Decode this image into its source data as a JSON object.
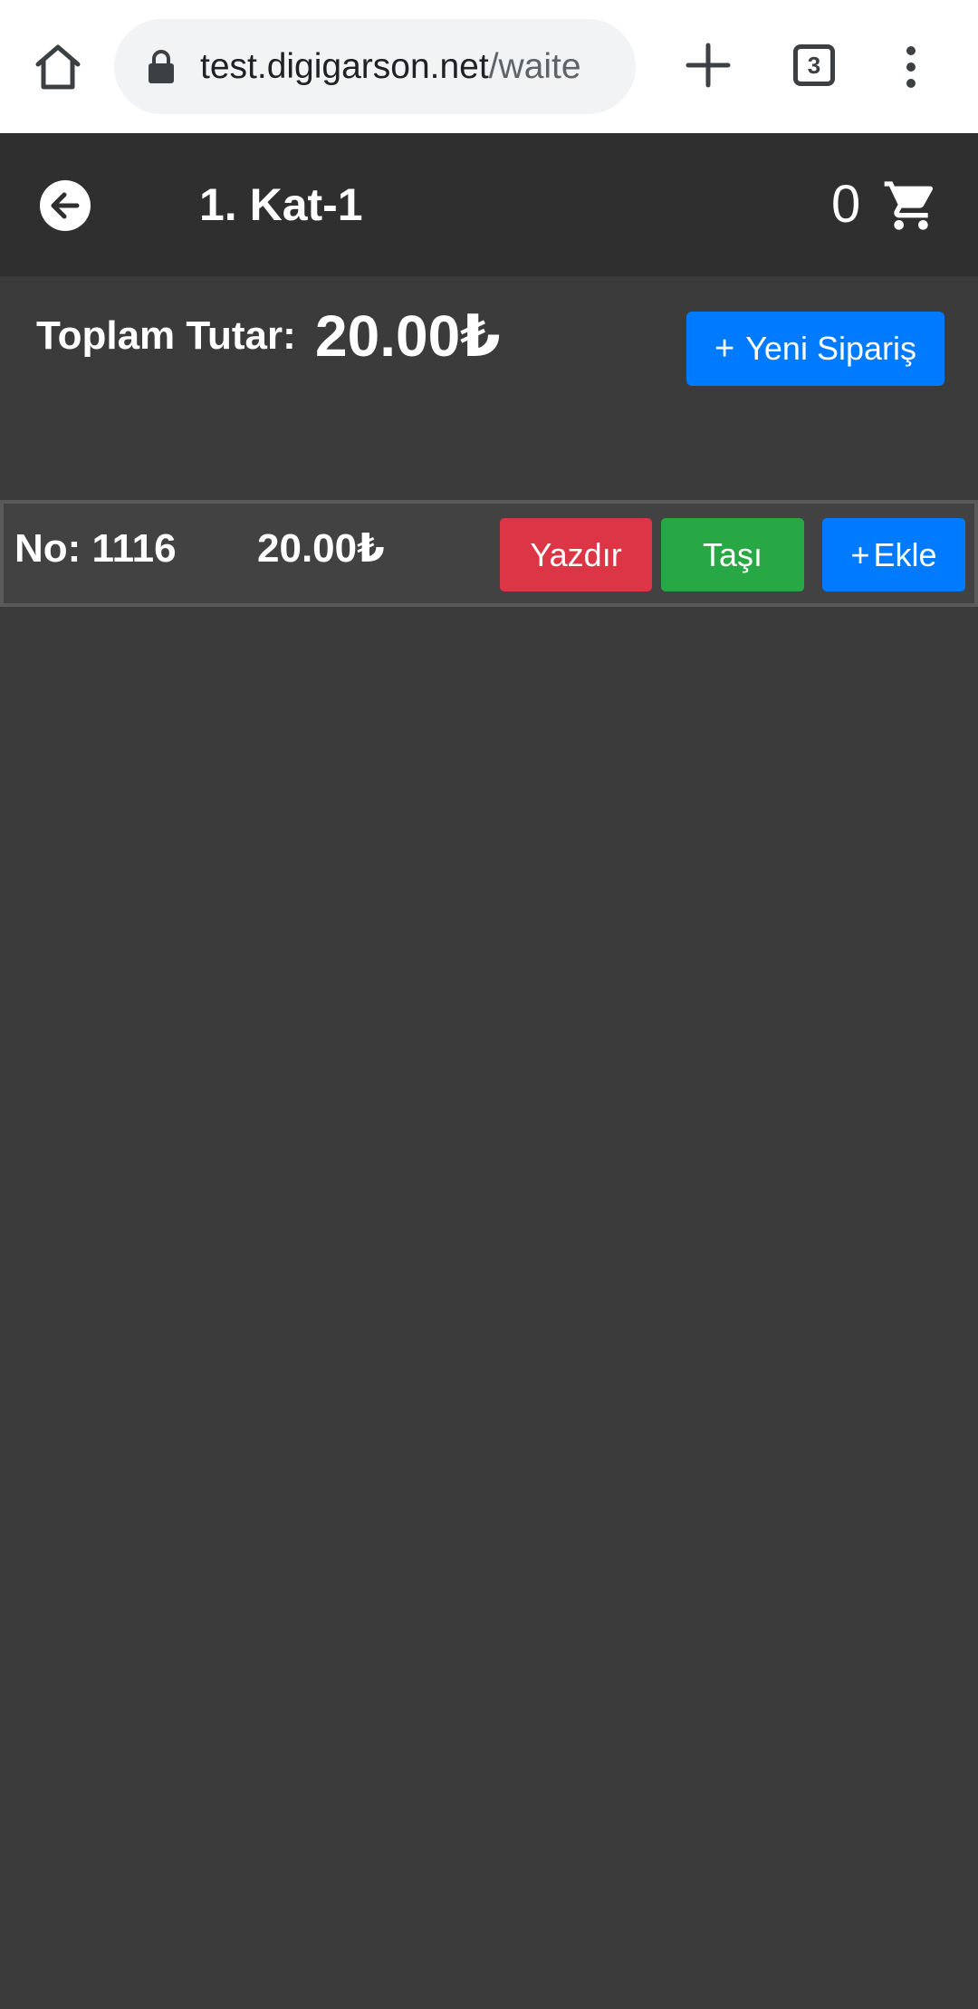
{
  "browser": {
    "url_host": "test.digigarson.net",
    "url_path": "/waite",
    "tab_count": "3"
  },
  "header": {
    "title": "1. Kat-1",
    "cart_count": "0"
  },
  "summary": {
    "total_label": "Toplam Tutar:",
    "total_value": "20.00₺",
    "new_order_label": "Yeni Sipariş"
  },
  "orders": [
    {
      "number": "No: 1116",
      "amount": "20.00₺",
      "print_label": "Yazdır",
      "move_label": "Taşı",
      "add_label": "Ekle"
    }
  ],
  "colors": {
    "background": "#3b3b3b",
    "header": "#2f2f2f",
    "primary": "#007bff",
    "danger": "#dc3545",
    "success": "#28a745"
  },
  "icons": {
    "home": "home-icon",
    "lock": "lock-icon",
    "new_tab": "plus-icon",
    "tabs": "tab-switcher-icon",
    "menu": "more-vert-icon",
    "back": "arrow-back-circle-icon",
    "cart": "shopping-cart-icon"
  }
}
